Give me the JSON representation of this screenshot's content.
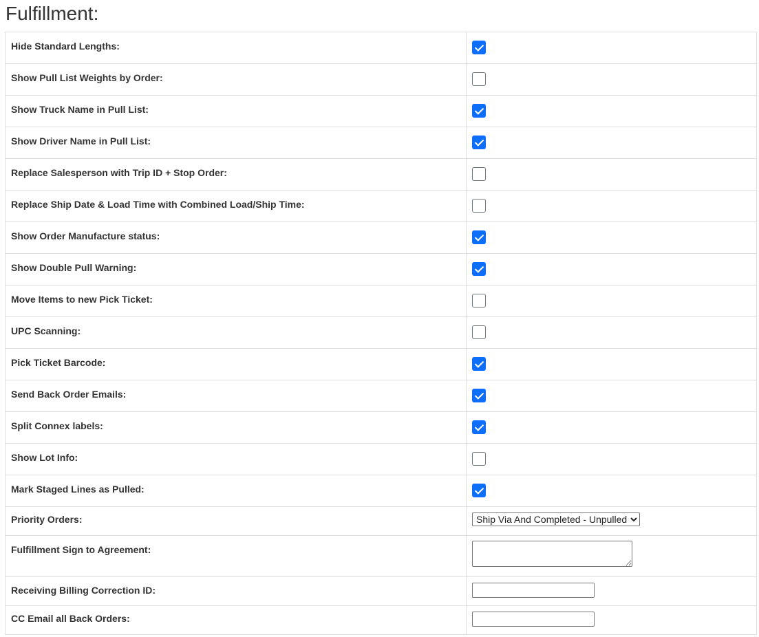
{
  "page": {
    "title": "Fulfillment:"
  },
  "settings": [
    {
      "label": "Hide Standard Lengths:",
      "checked": true
    },
    {
      "label": "Show Pull List Weights by Order:",
      "checked": false
    },
    {
      "label": "Show Truck Name in Pull List:",
      "checked": true
    },
    {
      "label": "Show Driver Name in Pull List:",
      "checked": true
    },
    {
      "label": "Replace Salesperson with Trip ID + Stop Order:",
      "checked": false
    },
    {
      "label": "Replace Ship Date & Load Time with Combined Load/Ship Time:",
      "checked": false
    },
    {
      "label": "Show Order Manufacture status:",
      "checked": true
    },
    {
      "label": "Show Double Pull Warning:",
      "checked": true
    },
    {
      "label": "Move Items to new Pick Ticket:",
      "checked": false
    },
    {
      "label": "UPC Scanning:",
      "checked": false
    },
    {
      "label": "Pick Ticket Barcode:",
      "checked": true
    },
    {
      "label": "Send Back Order Emails:",
      "checked": true
    },
    {
      "label": "Split Connex labels:",
      "checked": true
    },
    {
      "label": "Show Lot Info:",
      "checked": false
    },
    {
      "label": "Mark Staged Lines as Pulled:",
      "checked": true
    }
  ],
  "priority_orders": {
    "label": "Priority Orders:",
    "selected": "Ship Via And Completed - Unpulled"
  },
  "sign_agreement": {
    "label": "Fulfillment Sign to Agreement:",
    "value": ""
  },
  "billing_correction": {
    "label": "Receiving Billing Correction ID:",
    "value": ""
  },
  "cc_email": {
    "label": "CC Email all Back Orders:",
    "value": ""
  }
}
